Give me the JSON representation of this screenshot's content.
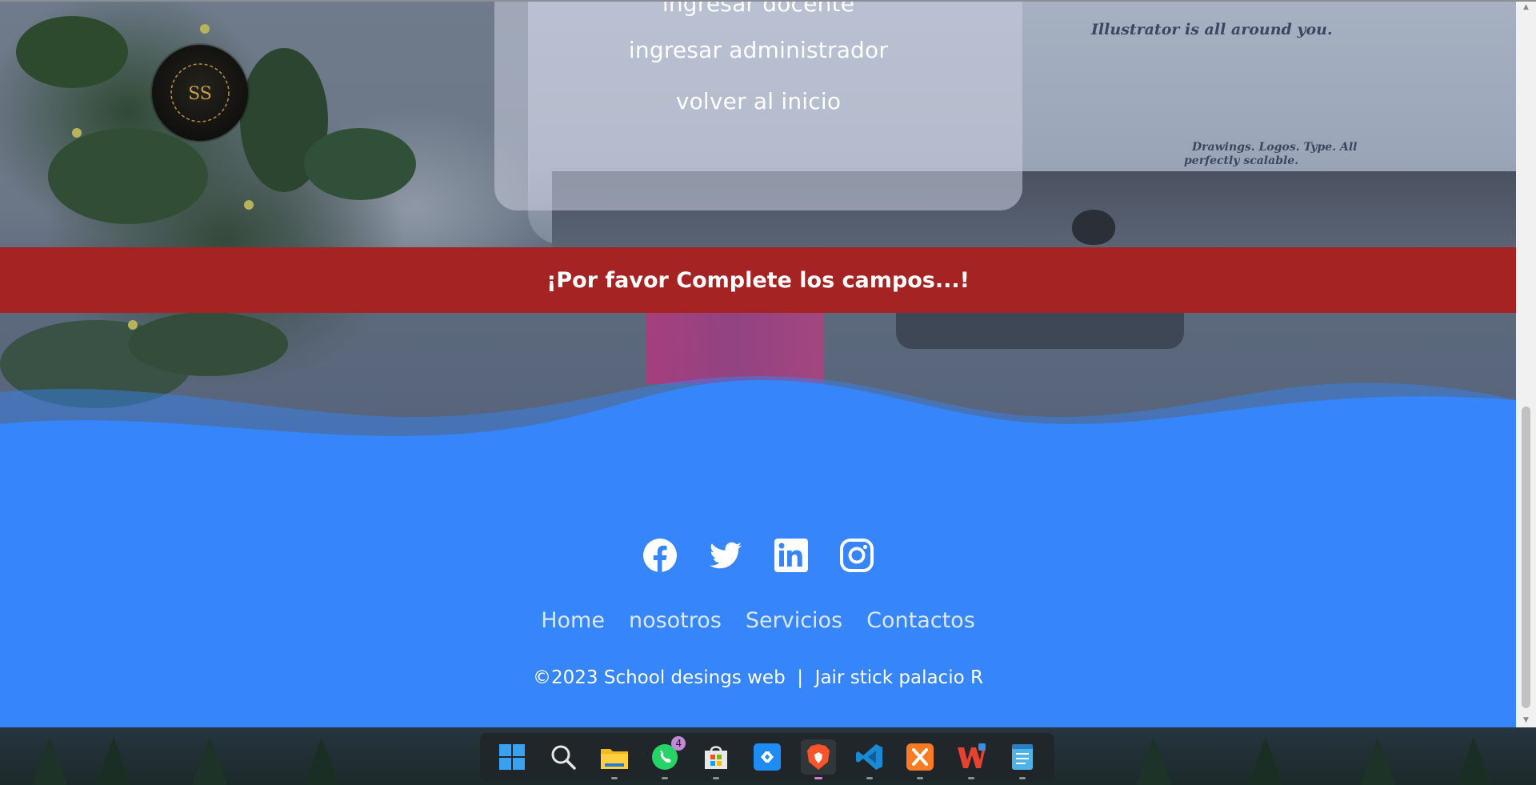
{
  "login_card": {
    "links": [
      "ingresar docente",
      "ingresar administrador",
      "volver al inicio"
    ]
  },
  "logo": {
    "monogram": "SS"
  },
  "alert": {
    "message": "¡Por favor Complete los campos...!",
    "color": "#a52323"
  },
  "monitor_screen": {
    "headline": "Illustrator is all around you.",
    "tagline_1": "Drawings. Logos. Type. All",
    "tagline_2": "perfectly scalable."
  },
  "footer": {
    "background": "#3685fb",
    "social": [
      "facebook-icon",
      "twitter-icon",
      "linkedin-icon",
      "instagram-icon"
    ],
    "nav": [
      "Home",
      "nosotros",
      "Servicios",
      "Contactos"
    ],
    "copyright": "©2023 School desings web  |  Jair stick palacio R"
  },
  "taskbar": {
    "apps": [
      "start-icon",
      "search-icon",
      "file-explorer-icon",
      "whatsapp-icon",
      "microsoft-store-icon",
      "connect-app-icon",
      "brave-browser-icon",
      "vscode-icon",
      "xampp-icon",
      "wps-office-icon",
      "notepad-icon"
    ],
    "whatsapp_badge": "4"
  }
}
